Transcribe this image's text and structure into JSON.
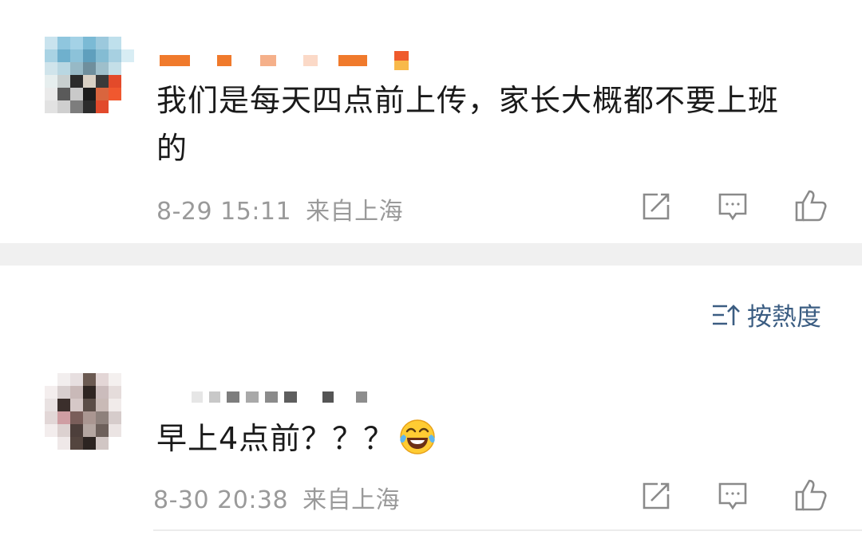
{
  "comments": [
    {
      "text_line1": "我们是每天四点前上传，家长大概都不要上班",
      "text_line2": "的",
      "date": "8-29",
      "time": "15:11",
      "location": "来自上海"
    },
    {
      "text": "早上4点前？？？",
      "date": "8-30",
      "time": "20:38",
      "location": "来自上海",
      "emoji": "laughing-tears-emoji"
    }
  ],
  "sort": {
    "icon": "sort-icon",
    "label": "按熱度"
  },
  "actions": {
    "share_icon": "share-icon",
    "reply_icon": "comment-icon",
    "like_icon": "thumbs-up-icon"
  },
  "colors": {
    "text": "#1a1a1a",
    "meta": "#9a9a9a",
    "accent": "#3b5d82",
    "separator": "#f0f0f0",
    "username_orange": "#f07a2c"
  }
}
